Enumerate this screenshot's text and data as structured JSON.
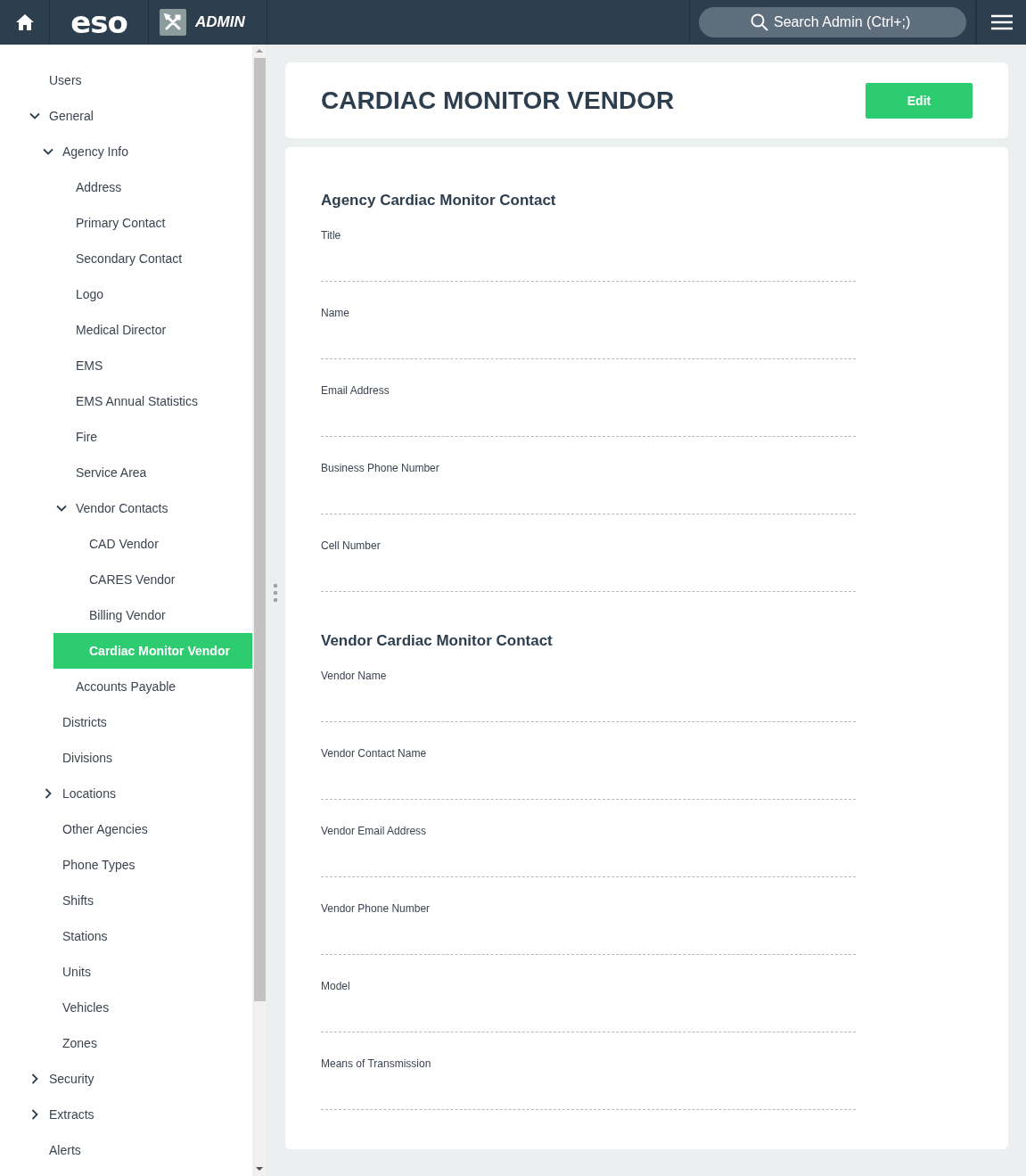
{
  "header": {
    "logo": "eso",
    "app_name": "ADMIN",
    "search": {
      "placeholder": "Search Admin (Ctrl+;)"
    }
  },
  "sidebar": {
    "items": [
      {
        "label": "Users",
        "selected": false
      },
      {
        "label": "General",
        "selected": false,
        "expanded": true,
        "children": [
          {
            "label": "Agency Info",
            "selected": false,
            "expanded": true,
            "children": [
              {
                "label": "Address",
                "selected": false
              },
              {
                "label": "Primary Contact",
                "selected": false
              },
              {
                "label": "Secondary Contact",
                "selected": false
              },
              {
                "label": "Logo",
                "selected": false
              },
              {
                "label": "Medical Director",
                "selected": false
              },
              {
                "label": "EMS",
                "selected": false
              },
              {
                "label": "EMS Annual Statistics",
                "selected": false
              },
              {
                "label": "Fire",
                "selected": false
              },
              {
                "label": "Service Area",
                "selected": false
              },
              {
                "label": "Vendor Contacts",
                "selected": false,
                "expanded": true,
                "children": [
                  {
                    "label": "CAD Vendor",
                    "selected": false
                  },
                  {
                    "label": "CARES Vendor",
                    "selected": false
                  },
                  {
                    "label": "Billing Vendor",
                    "selected": false
                  },
                  {
                    "label": "Cardiac Monitor Vendor",
                    "selected": true
                  }
                ]
              },
              {
                "label": "Accounts Payable",
                "selected": false
              }
            ]
          },
          {
            "label": "Districts",
            "selected": false
          },
          {
            "label": "Divisions",
            "selected": false
          },
          {
            "label": "Locations",
            "selected": false,
            "expanded": false
          },
          {
            "label": "Other Agencies",
            "selected": false
          },
          {
            "label": "Phone Types",
            "selected": false
          },
          {
            "label": "Shifts",
            "selected": false
          },
          {
            "label": "Stations",
            "selected": false
          },
          {
            "label": "Units",
            "selected": false
          },
          {
            "label": "Vehicles",
            "selected": false
          },
          {
            "label": "Zones",
            "selected": false
          }
        ]
      },
      {
        "label": "Security",
        "selected": false,
        "expanded": false
      },
      {
        "label": "Extracts",
        "selected": false,
        "expanded": false
      },
      {
        "label": "Alerts",
        "selected": false
      }
    ]
  },
  "page": {
    "title": "CARDIAC MONITOR VENDOR",
    "edit_button": "Edit",
    "sections": [
      {
        "title": "Agency Cardiac Monitor Contact",
        "fields": [
          {
            "label": "Title"
          },
          {
            "label": "Name"
          },
          {
            "label": "Email Address"
          },
          {
            "label": "Business Phone Number"
          },
          {
            "label": "Cell Number"
          }
        ]
      },
      {
        "title": "Vendor Cardiac Monitor Contact",
        "fields": [
          {
            "label": "Vendor Name"
          },
          {
            "label": "Vendor Contact Name"
          },
          {
            "label": "Vendor Email Address"
          },
          {
            "label": "Vendor Phone Number"
          },
          {
            "label": "Model"
          },
          {
            "label": "Means of Transmission"
          }
        ]
      }
    ]
  }
}
